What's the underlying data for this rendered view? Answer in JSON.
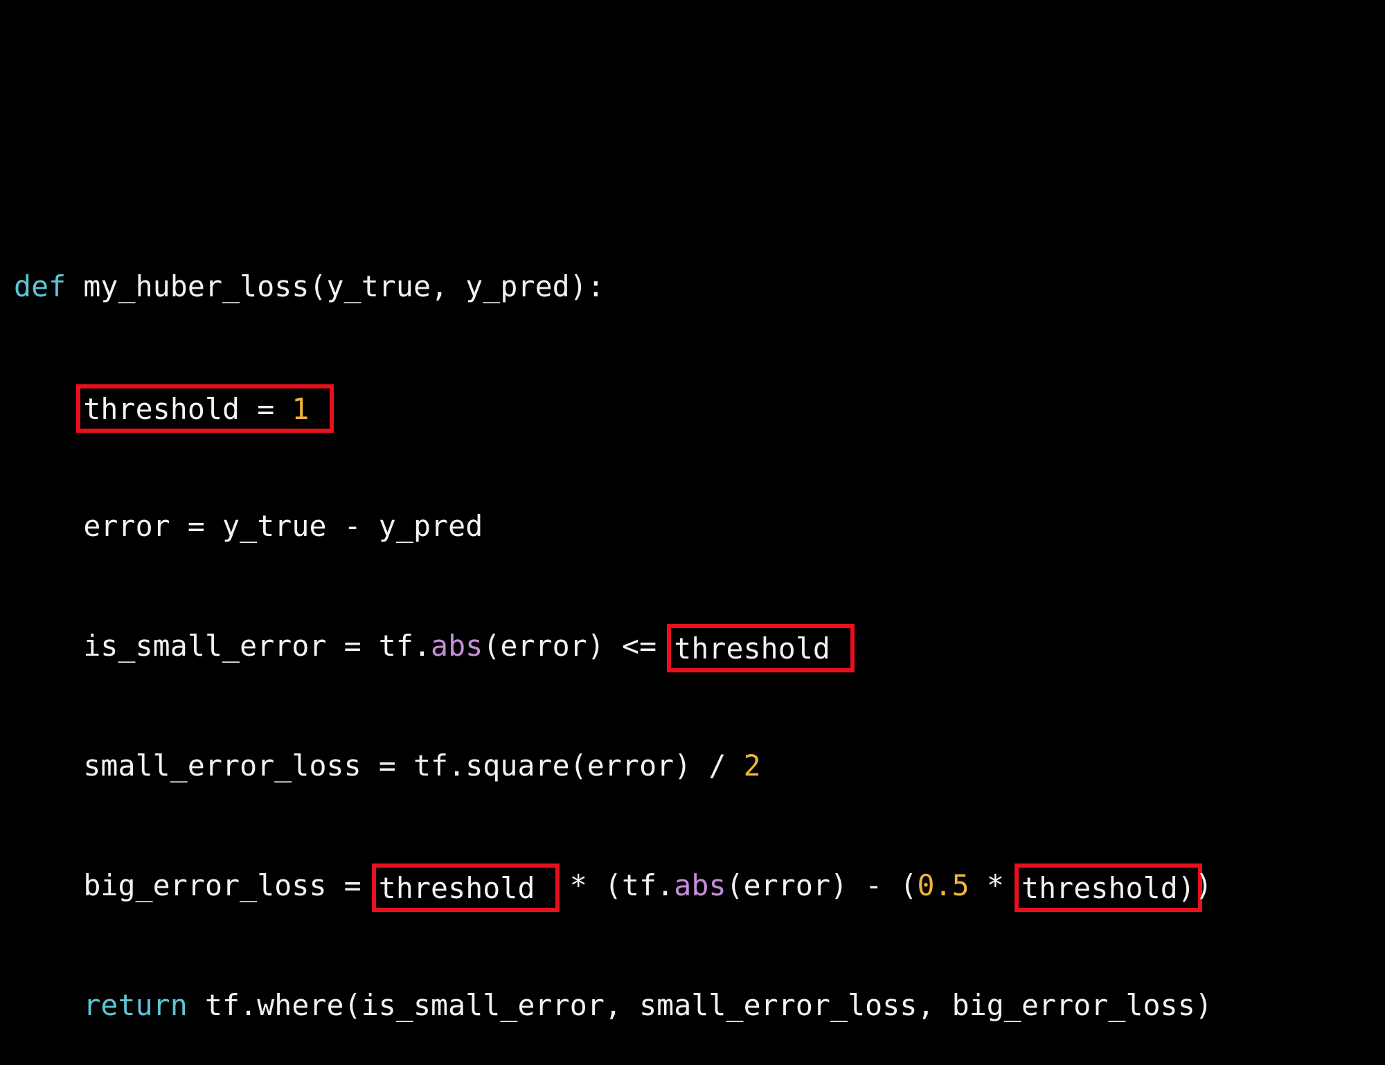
{
  "colors": {
    "background": "#000000",
    "text": "#f2f2f2",
    "keyword": "#5ec4d6",
    "number": "#f0b43c",
    "builtin": "#c48fd8",
    "highlight_box": "#e8101c"
  },
  "code": {
    "l1": {
      "kw": "def",
      "rest": " my_huber_loss(y_true, y_pred):"
    },
    "l2": {
      "indent": "    ",
      "name": "threshold",
      "eq": " = ",
      "val": "1"
    },
    "l3": {
      "indent": "    ",
      "text": "error = y_true - y_pred"
    },
    "l4": {
      "indent": "    ",
      "pre": "is_small_error = tf.",
      "fn": "abs",
      "mid": "(error) <= ",
      "box": "threshold"
    },
    "l5": {
      "indent": "    ",
      "pre": "small_error_loss = tf.square(error) / ",
      "num": "2"
    },
    "l6": {
      "indent": "    ",
      "pre": "big_error_loss = ",
      "box1": "threshold",
      "mid1": " * (tf.",
      "fn": "abs",
      "mid2": "(error) - (",
      "num": "0.5",
      "mid3": " * ",
      "box2": "threshold)",
      "end": ")"
    },
    "l7": {
      "indent": "    ",
      "kw": "return",
      "rest": " tf.where(is_small_error, small_error_loss, big_error_loss)"
    }
  }
}
